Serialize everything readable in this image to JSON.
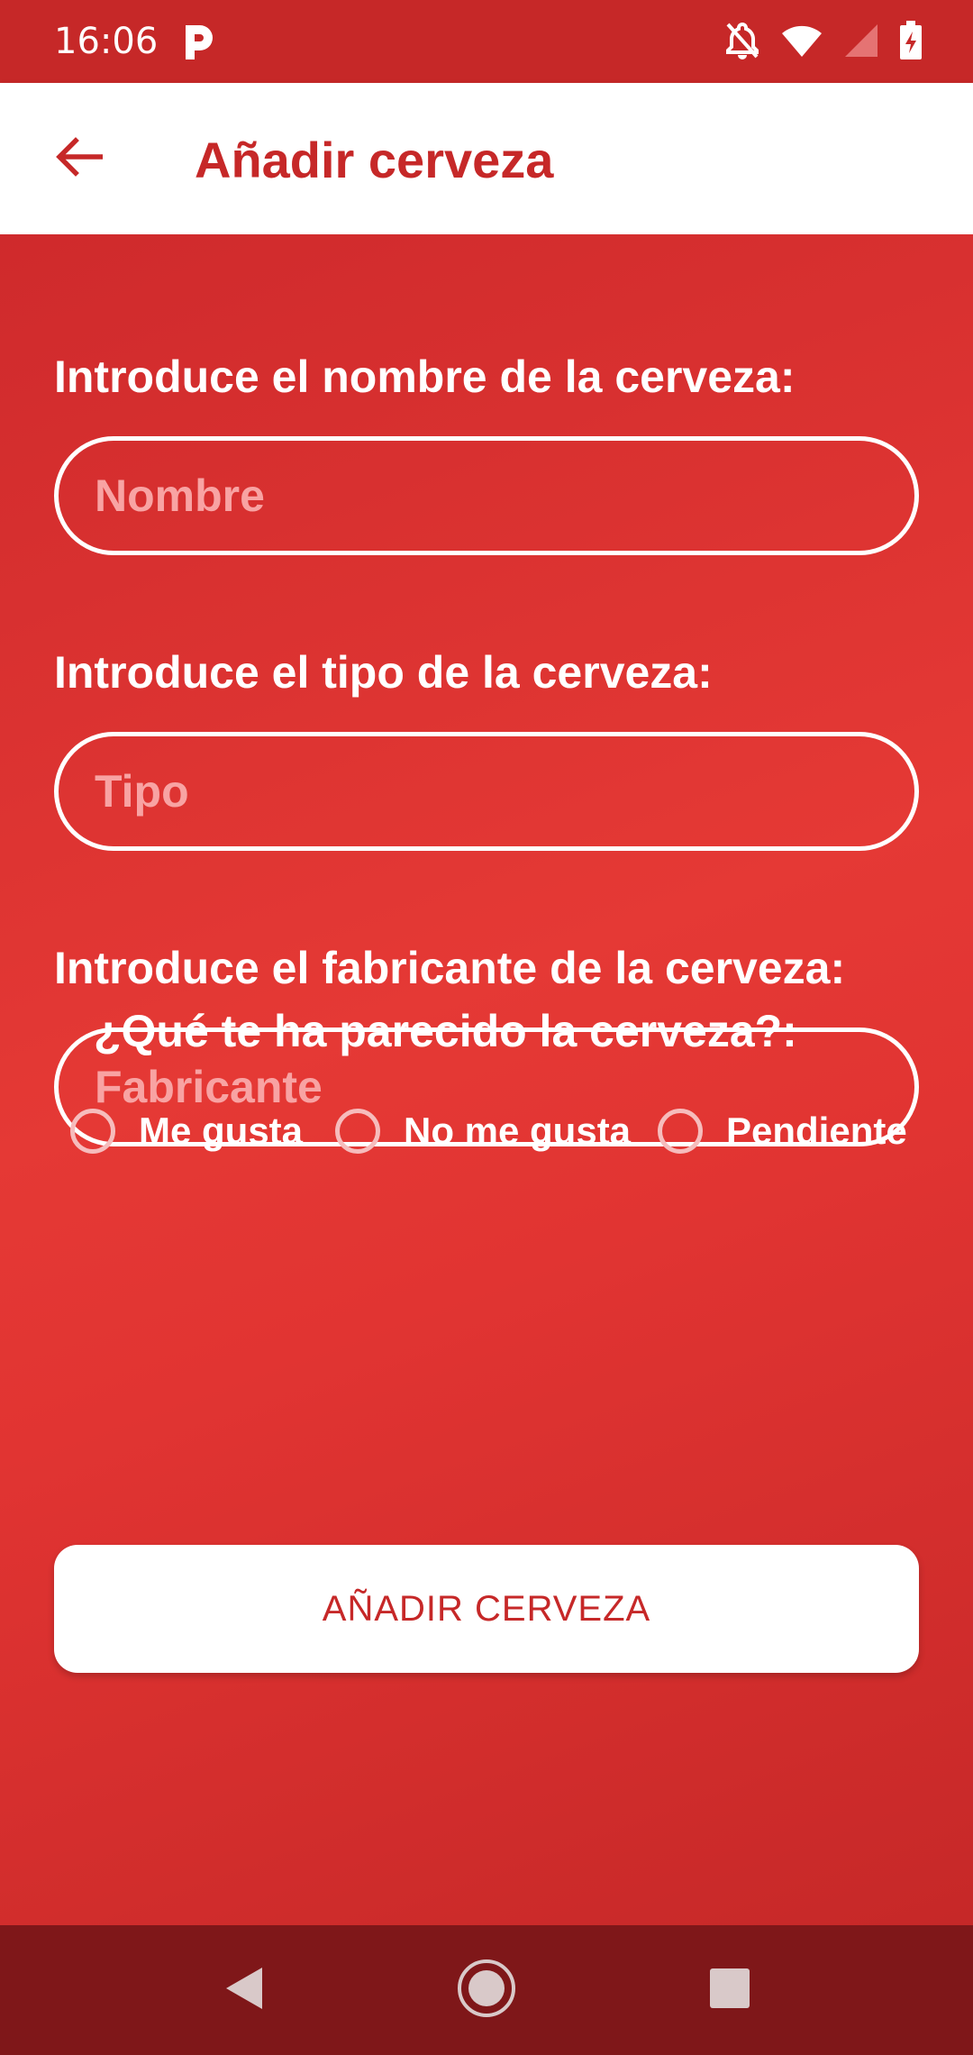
{
  "status_bar": {
    "time": "16:06",
    "icons": [
      "parking-app-icon",
      "notifications-off-icon",
      "wifi-icon",
      "cell-signal-icon",
      "battery-charging-icon"
    ]
  },
  "app_bar": {
    "title": "Añadir cerveza",
    "back_icon": "arrow-back-icon"
  },
  "form": {
    "name_label": "Introduce el nombre de la cerveza:",
    "name_placeholder": "Nombre",
    "type_label": "Introduce el tipo de la cerveza:",
    "type_placeholder": "Tipo",
    "maker_label": "Introduce el fabricante de la cerveza:",
    "maker_placeholder": "Fabricante",
    "opinion_question": "¿Qué te ha parecido la cerveza?:",
    "opinion_options": [
      "Me gusta",
      "No me gusta",
      "Pendiente"
    ],
    "submit_label": "AÑADIR CERVEZA"
  },
  "nav_bar": {
    "icons": [
      "nav-back-icon",
      "nav-home-icon",
      "nav-recents-icon"
    ]
  },
  "colors": {
    "primary": "#c62828",
    "background": "#e53935",
    "nav_bar": "#7f1719",
    "placeholder": "#f8a3a3"
  }
}
